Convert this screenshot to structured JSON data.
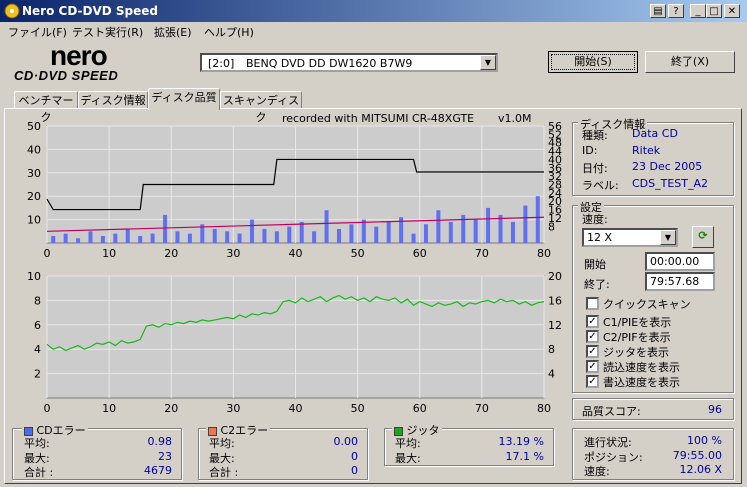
{
  "window": {
    "title": "Nero CD-DVD Speed",
    "colors": {
      "titlebar": "#0a246a"
    }
  },
  "menu": [
    "ファイル(F)",
    "テスト実行(R)",
    "拡張(E)",
    "ヘルプ(H)"
  ],
  "logo": {
    "line1": "nero",
    "line2": "CD·DVD SPEED"
  },
  "drive": {
    "slot": "[2:0]",
    "name": "BENQ DVD DD DW1620 B7W9"
  },
  "buttons": {
    "start": "開始(S)",
    "exit": "終了(X)"
  },
  "tabs": [
    "ベンチマーク",
    "ディスク情報",
    "ディスク品質",
    "スキャンディスク"
  ],
  "active_tab": "ディスク品質",
  "chart_caption": "recorded with MITSUMI CR-48XGTE",
  "chart_version": "v1.0M",
  "disc_info": {
    "title": "ディスク情報",
    "rows": [
      {
        "label": "種類:",
        "value": "Data CD"
      },
      {
        "label": "ID:",
        "value": "Ritek"
      },
      {
        "label": "日付:",
        "value": "23 Dec 2005"
      },
      {
        "label": "ラベル:",
        "value": "CDS_TEST_A2"
      }
    ]
  },
  "settings": {
    "title": "設定",
    "speed_label": "速度:",
    "speed_value": "12 X",
    "start_label": "開始",
    "start_value": "00:00.00",
    "end_label": "終了:",
    "end_value": "79:57.68",
    "checkboxes": [
      {
        "label": "クイックスキャン",
        "checked": false
      },
      {
        "label": "C1/PIEを表示",
        "checked": true
      },
      {
        "label": "C2/PIFを表示",
        "checked": true
      },
      {
        "label": "ジッタを表示",
        "checked": true
      },
      {
        "label": "読込速度を表示",
        "checked": true
      },
      {
        "label": "書込速度を表示",
        "checked": true
      }
    ]
  },
  "quality": {
    "label": "品質スコア:",
    "value": "96"
  },
  "progress": {
    "rows": [
      {
        "label": "進行状況:",
        "value": "100 %"
      },
      {
        "label": "ポジション:",
        "value": "79:55.00"
      },
      {
        "label": "速度:",
        "value": "12.06 X"
      }
    ]
  },
  "stats": {
    "cd_errors": {
      "title": "CDエラー",
      "color": "#4a6cf4",
      "rows": [
        {
          "label": "平均:",
          "value": "0.98"
        },
        {
          "label": "最大:",
          "value": "23"
        },
        {
          "label": "合計 :",
          "value": "4679"
        }
      ]
    },
    "c2_errors": {
      "title": "C2エラー",
      "color": "#f07848",
      "rows": [
        {
          "label": "平均:",
          "value": "0.00"
        },
        {
          "label": "最大:",
          "value": "0"
        },
        {
          "label": "合計 :",
          "value": "0"
        }
      ]
    },
    "jitter": {
      "title": "ジッタ",
      "color": "#18a818",
      "rows": [
        {
          "label": "平均:",
          "value": "13.19 %"
        },
        {
          "label": "最大:",
          "value": "17.1 %"
        }
      ]
    }
  },
  "chart_data": [
    {
      "type": "bar+line",
      "xlim": [
        0,
        80
      ],
      "ylim_left": [
        0,
        50
      ],
      "ylim_right": [
        0,
        56
      ],
      "x_ticks": [
        0,
        10,
        20,
        30,
        40,
        50,
        60,
        70,
        80
      ],
      "y_ticks_left": [
        10,
        20,
        30,
        40,
        50
      ],
      "y_ticks_right": [
        8,
        12,
        16,
        20,
        24,
        28,
        32,
        36,
        40,
        44,
        48,
        52,
        56
      ],
      "series": [
        {
          "kind": "bars",
          "color": "#6070f0",
          "x": [
            1,
            3,
            5,
            7,
            9,
            11,
            13,
            15,
            17,
            19,
            21,
            23,
            25,
            27,
            29,
            31,
            33,
            35,
            37,
            39,
            41,
            43,
            45,
            47,
            49,
            51,
            53,
            55,
            57,
            59,
            61,
            63,
            65,
            67,
            69,
            71,
            73,
            75,
            77,
            79
          ],
          "values": [
            3,
            4,
            2,
            5,
            3,
            4,
            6,
            3,
            4,
            12,
            5,
            4,
            8,
            6,
            5,
            4,
            10,
            6,
            5,
            7,
            9,
            5,
            14,
            6,
            8,
            10,
            7,
            9,
            11,
            4,
            8,
            14,
            9,
            12,
            10,
            15,
            12,
            9,
            16,
            20
          ]
        },
        {
          "kind": "line",
          "color": "#000000",
          "x": [
            0,
            1,
            15,
            15.5,
            36.5,
            37,
            59,
            59.5,
            80
          ],
          "values": [
            21,
            16,
            16,
            28,
            28,
            40,
            40,
            34,
            34
          ]
        },
        {
          "kind": "line",
          "color": "#c00060",
          "x": [
            0,
            20,
            40,
            60,
            80
          ],
          "values": [
            5,
            6.5,
            8,
            9.5,
            11
          ]
        }
      ]
    },
    {
      "type": "line",
      "xlim": [
        0,
        80
      ],
      "ylim_left": [
        0,
        10
      ],
      "ylim_right": [
        0,
        20
      ],
      "x_ticks": [
        0,
        10,
        20,
        30,
        40,
        50,
        60,
        70,
        80
      ],
      "y_ticks_left": [
        2,
        4,
        6,
        8,
        10
      ],
      "y_ticks_right": [
        4,
        8,
        12,
        16,
        20
      ],
      "series": [
        {
          "kind": "line",
          "color": "#18b818",
          "x": [
            0,
            1,
            2,
            3,
            4,
            5,
            6,
            7,
            8,
            9,
            10,
            11,
            12,
            13,
            14,
            15,
            16,
            17,
            18,
            19,
            20,
            21,
            22,
            23,
            24,
            25,
            26,
            27,
            28,
            29,
            30,
            31,
            32,
            33,
            34,
            35,
            36,
            37,
            38,
            39,
            40,
            41,
            42,
            43,
            44,
            45,
            46,
            47,
            48,
            49,
            50,
            51,
            52,
            53,
            54,
            55,
            56,
            57,
            58,
            59,
            60,
            61,
            62,
            63,
            64,
            65,
            66,
            67,
            68,
            69,
            70,
            71,
            72,
            73,
            74,
            75,
            76,
            77,
            78,
            79,
            80
          ],
          "values": [
            4.4,
            4.0,
            4.2,
            3.9,
            4.1,
            4.3,
            4.0,
            4.2,
            4.5,
            4.4,
            4.6,
            4.3,
            4.7,
            4.5,
            4.6,
            4.8,
            5.9,
            6.0,
            5.8,
            6.1,
            6.0,
            6.2,
            6.1,
            6.3,
            6.2,
            6.4,
            6.3,
            6.4,
            6.5,
            6.6,
            6.5,
            6.8,
            6.6,
            6.9,
            6.8,
            7.0,
            6.9,
            7.1,
            7.9,
            8.0,
            7.8,
            8.2,
            7.9,
            8.1,
            8.3,
            7.9,
            8.2,
            8.4,
            8.1,
            8.3,
            8.0,
            8.2,
            7.9,
            8.3,
            8.1,
            8.0,
            8.2,
            7.8,
            8.1,
            7.6,
            7.9,
            7.7,
            7.5,
            7.8,
            7.6,
            7.7,
            7.9,
            7.5,
            7.8,
            7.7,
            7.9,
            8.0,
            7.8,
            8.1,
            7.9,
            8.0,
            7.7,
            7.9,
            7.6,
            7.8,
            7.9
          ]
        }
      ]
    }
  ]
}
